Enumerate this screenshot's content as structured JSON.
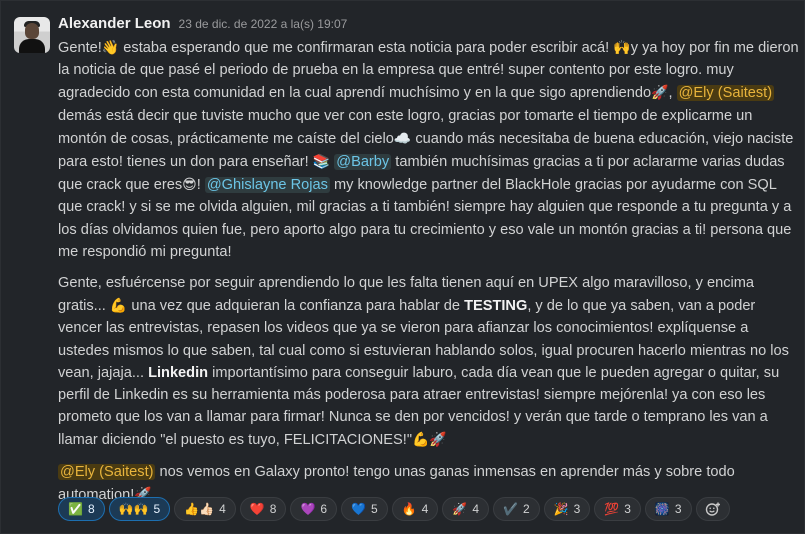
{
  "author": "Alexander Leon",
  "timestamp": "23 de dic. de 2022 a la(s) 19:07",
  "message": {
    "p1": [
      "Gente!",
      "👋",
      " estaba esperando que me confirmaran esta noticia para poder escribir acá! ",
      "🙌",
      "y ya hoy por fin me dieron la noticia de que pasé el periodo de prueba en la empresa que entré! super contento por este logro. muy agradecido con esta comunidad en la cual aprendí muchísimo y en la que sigo aprendiendo",
      "🚀",
      ", ",
      "@Ely (Saitest)",
      " demás está decir que tuviste mucho que ver con este logro, gracias por tomarte el tiempo de explicarme un montón de cosas, prácticamente me caíste del cielo",
      "☁️",
      " cuando más necesitaba de buena educación, viejo naciste para esto! tienes un don para enseñar! ",
      "📚",
      " ",
      "@Barby",
      " también muchísimas gracias a ti por aclararme varias dudas que crack que eres",
      "😎",
      "! ",
      "@Ghislayne Rojas",
      " my knowledge partner del BlackHole gracias por ayudarme con SQL que crack!  y si se me olvida alguien, mil gracias a ti también!  siempre hay alguien que responde a tu pregunta y a los días olvidamos quien fue, pero aporto algo para tu crecimiento y eso vale un montón gracias a ti! persona que me respondió mi pregunta!"
    ],
    "p2": [
      "Gente, esfuércense por seguir aprendiendo lo que les falta tienen aquí en UPEX algo maravilloso, y encima gratis... ",
      "💪",
      " una vez que adquieran la confianza para hablar de ",
      "TESTING",
      ", y de lo que ya saben, van a poder vencer las entrevistas, repasen los videos que ya se vieron para afianzar los conocimientos!  explíquense a ustedes mismos lo que saben, tal cual como si estuvieran hablando solos, igual procuren hacerlo mientras no los vean, jajaja...  ",
      "Linkedin",
      " importantísimo para conseguir laburo, cada día vean que le pueden agregar o quitar, su perfil de Linkedin es su herramienta más poderosa para atraer entrevistas! siempre mejórenla! ya  con eso les prometo que los van a llamar para firmar!  Nunca se den por vencidos! y verán que tarde o temprano les van a llamar diciendo \"el puesto es tuyo, FELICITACIONES!\"",
      "💪🚀"
    ],
    "p3": [
      "@Ely (Saitest)",
      " nos vemos en Galaxy pronto! tengo unas ganas inmensas en aprender más y sobre todo automation!",
      "🚀"
    ]
  },
  "reactions": [
    {
      "emoji": "✅",
      "count": "8",
      "active": true
    },
    {
      "emoji": "🙌🙌",
      "count": "5",
      "active": true
    },
    {
      "emoji": "👍👍🏻",
      "count": "4",
      "active": false
    },
    {
      "emoji": "❤️",
      "count": "8",
      "active": false
    },
    {
      "emoji": "💜",
      "count": "6",
      "active": false
    },
    {
      "emoji": "💙",
      "count": "5",
      "active": false
    },
    {
      "emoji": "🔥",
      "count": "4",
      "active": false
    },
    {
      "emoji": "🚀",
      "count": "4",
      "active": false
    },
    {
      "emoji": "✔️",
      "count": "2",
      "active": false
    },
    {
      "emoji": "🎉",
      "count": "3",
      "active": false
    },
    {
      "emoji": "💯",
      "count": "3",
      "active": false
    },
    {
      "emoji": "🎆",
      "count": "3",
      "active": false
    }
  ]
}
